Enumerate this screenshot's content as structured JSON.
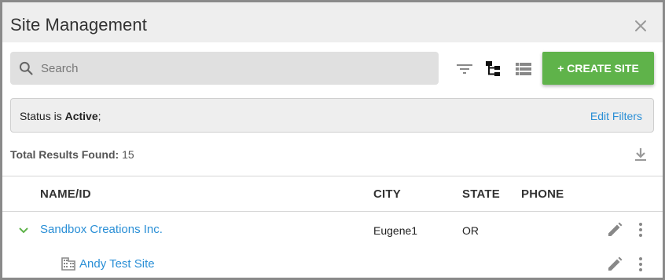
{
  "window": {
    "title": "Site Management",
    "close_icon": "close-icon"
  },
  "toolbar": {
    "search_placeholder": "Search",
    "search_value": "",
    "search_icon": "search-icon",
    "filter_icon": "filter-icon",
    "tree_view_icon": "tree-view-icon",
    "list_view_icon": "list-view-icon",
    "create_label": "+ CREATE SITE",
    "create_color": "#5fb34a"
  },
  "filters": {
    "prefix": "Status is ",
    "value": "Active",
    "suffix": ";",
    "edit_label": "Edit Filters"
  },
  "results": {
    "label": "Total Results Found:",
    "count": "15",
    "download_icon": "download-icon"
  },
  "table": {
    "headers": {
      "name": "NAME/ID",
      "city": "CITY",
      "state": "STATE",
      "phone": "PHONE"
    },
    "rows": [
      {
        "name": "Sandbox Creations Inc.",
        "city": "Eugene1",
        "state": "OR",
        "phone": "",
        "expand_icon": "chevron-down-icon",
        "type": "organization"
      },
      {
        "name": "Andy Test Site",
        "city": "",
        "state": "",
        "phone": "",
        "site_icon": "building-icon",
        "type": "site"
      }
    ]
  },
  "colors": {
    "accent": "#2a8fd6",
    "primary_button": "#5fb34a",
    "expand_chevron": "#5fb34a"
  }
}
